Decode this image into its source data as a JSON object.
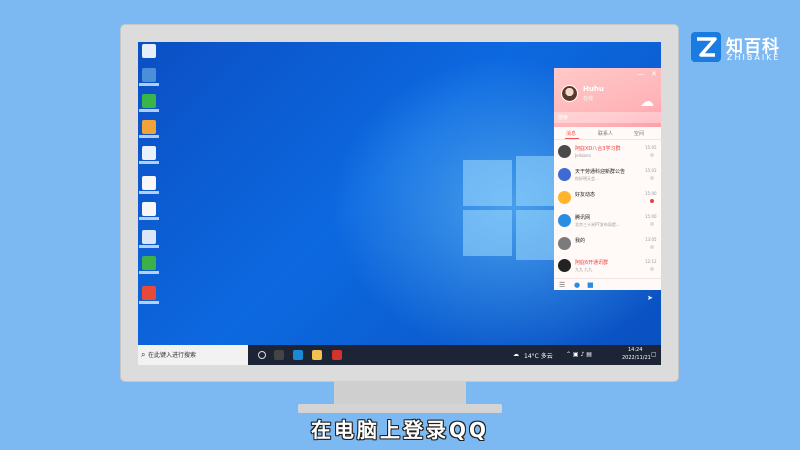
{
  "watermark": {
    "brand_cn": "知百科",
    "brand_en": "ZHIBAIKE"
  },
  "taskbar": {
    "search_placeholder": "在此键入进行搜索",
    "weather": "14°C 多云",
    "time": "14:24",
    "date": "2022/11/21"
  },
  "qq": {
    "profile_name": "Huhu",
    "profile_status": "在线",
    "search_placeholder": "搜索",
    "tabs": [
      {
        "label": "消息"
      },
      {
        "label": "联系人"
      },
      {
        "label": "空间"
      }
    ],
    "messages": [
      {
        "title": "阿庇XD八合3学习群",
        "subtitle": "Jellubnn",
        "time": "15:05",
        "icon_color": "#4a4a4a",
        "title_color": "#e54545",
        "dot_color": "#dddddd"
      },
      {
        "title": "天干劳通科迎新群公告",
        "subtitle": "你好明天会...",
        "time": "15:03",
        "icon_color": "#3d6bd1",
        "title_color": "#222222",
        "dot_color": "#dddddd"
      },
      {
        "title": "好友动态",
        "subtitle": "",
        "time": "15:00",
        "icon_color": "#ffb52b",
        "title_color": "#222222",
        "dot_color": "#e54545"
      },
      {
        "title": "腾讯网",
        "subtitle": "北京三十米PT发布局提...",
        "time": "15:00",
        "icon_color": "#2a8de3",
        "title_color": "#222222",
        "dot_color": "#dddddd"
      },
      {
        "title": "我的",
        "subtitle": "",
        "time": "13:05",
        "icon_color": "#7b7b7b",
        "title_color": "#222222",
        "dot_color": "#dddddd"
      },
      {
        "title": "阿庇6开通讯群",
        "subtitle": "九九 九九",
        "time": "12:12",
        "icon_color": "#222222",
        "title_color": "#e54545",
        "dot_color": "#dddddd"
      }
    ]
  },
  "subtitle": "在电脑上登录QQ"
}
